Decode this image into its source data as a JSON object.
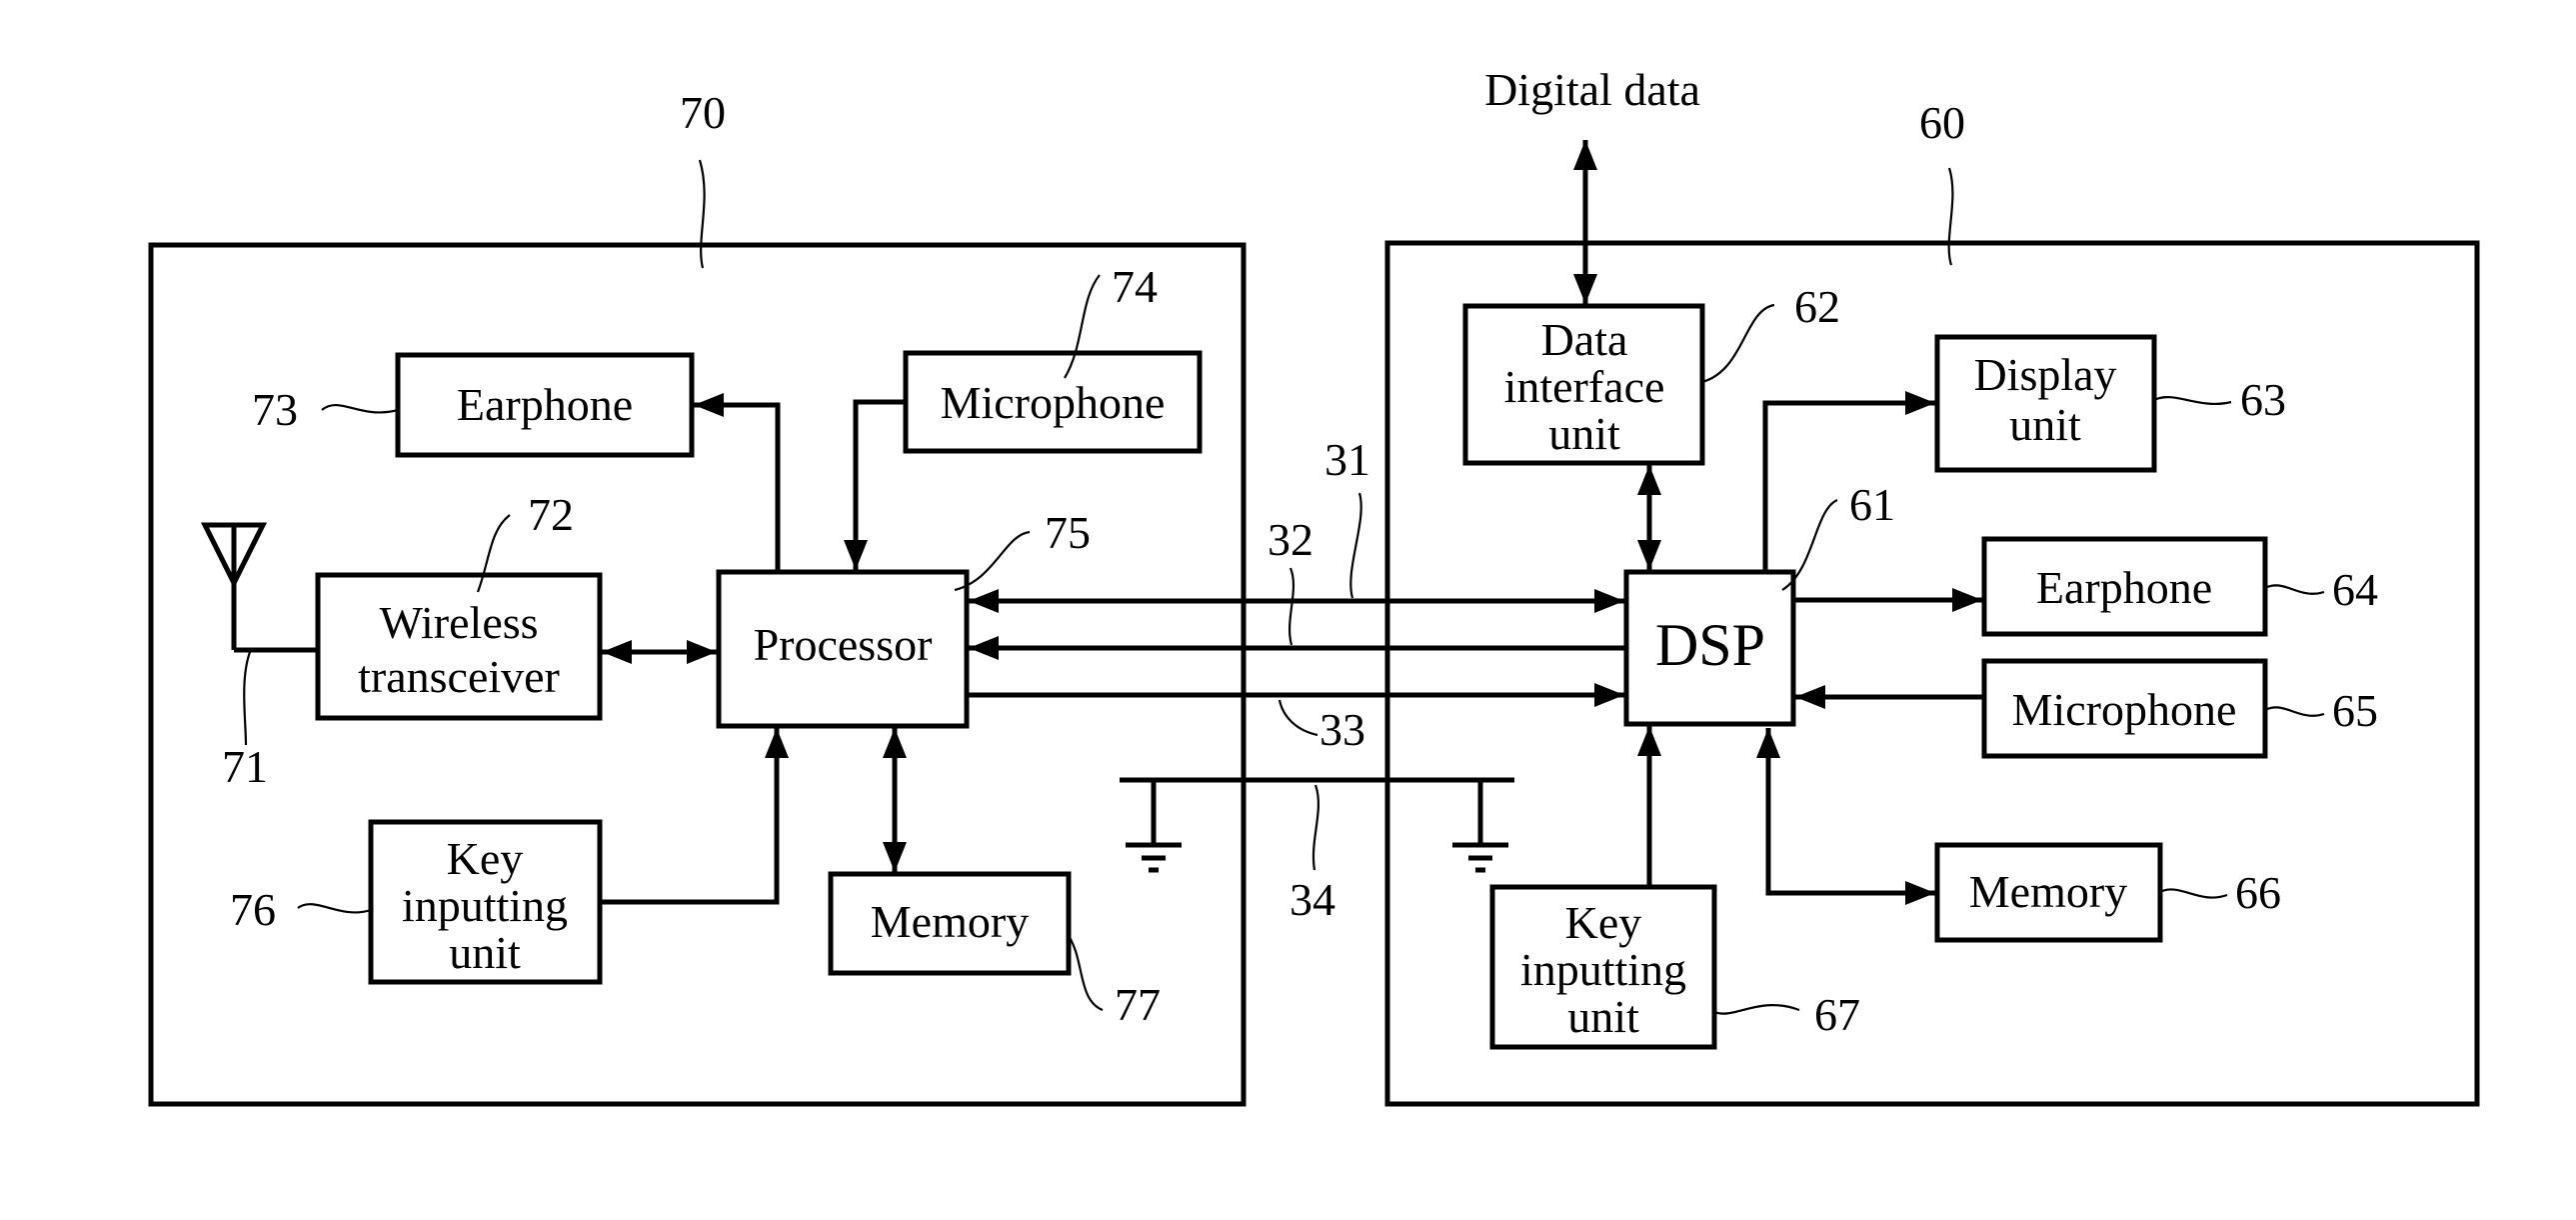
{
  "diagram": {
    "external_label": "Digital data",
    "left_device": {
      "ref": "70",
      "blocks": {
        "earphone": {
          "ref": "73",
          "lines": [
            "Earphone"
          ]
        },
        "microphone": {
          "ref": "74",
          "lines": [
            "Microphone"
          ]
        },
        "wireless": {
          "ref": "72",
          "lines": [
            "Wireless",
            "transceiver"
          ]
        },
        "antenna": {
          "ref": "71"
        },
        "processor": {
          "ref": "75",
          "lines": [
            "Processor"
          ]
        },
        "key": {
          "ref": "76",
          "lines": [
            "Key",
            "inputting",
            "unit"
          ]
        },
        "memory": {
          "ref": "77",
          "lines": [
            "Memory"
          ]
        }
      }
    },
    "right_device": {
      "ref": "60",
      "blocks": {
        "data_iface": {
          "ref": "62",
          "lines": [
            "Data",
            "interface",
            "unit"
          ]
        },
        "display": {
          "ref": "63",
          "lines": [
            "Display",
            "unit"
          ]
        },
        "dsp": {
          "ref": "61",
          "lines": [
            "DSP"
          ]
        },
        "earphone": {
          "ref": "64",
          "lines": [
            "Earphone"
          ]
        },
        "microphone": {
          "ref": "65",
          "lines": [
            "Microphone"
          ]
        },
        "memory": {
          "ref": "66",
          "lines": [
            "Memory"
          ]
        },
        "key": {
          "ref": "67",
          "lines": [
            "Key",
            "inputting",
            "unit"
          ]
        }
      }
    },
    "links": {
      "line_31": "31",
      "line_32": "32",
      "line_33": "33",
      "ground_34": "34"
    }
  }
}
